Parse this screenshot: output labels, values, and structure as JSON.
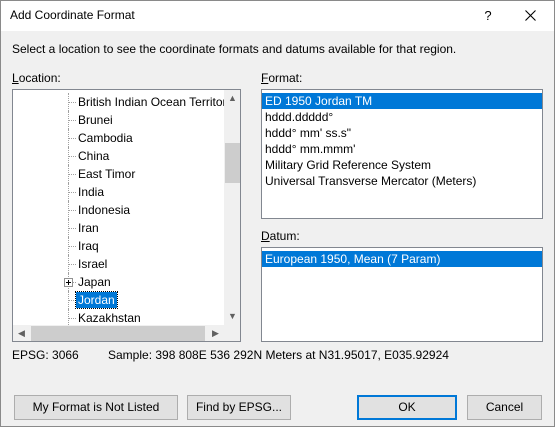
{
  "window": {
    "title": "Add Coordinate Format",
    "help_label": "?"
  },
  "instruction": "Select a location to see the coordinate formats and datums available for that region.",
  "location": {
    "label_accel": "L",
    "label_rest": "ocation:",
    "items": [
      {
        "label": "British Indian Ocean Territory"
      },
      {
        "label": "Brunei"
      },
      {
        "label": "Cambodia"
      },
      {
        "label": "China"
      },
      {
        "label": "East Timor"
      },
      {
        "label": "India"
      },
      {
        "label": "Indonesia"
      },
      {
        "label": "Iran"
      },
      {
        "label": "Iraq"
      },
      {
        "label": "Israel"
      },
      {
        "label": "Japan",
        "expandable": true
      },
      {
        "label": "Jordan",
        "selected": true
      },
      {
        "label": "Kazakhstan"
      }
    ]
  },
  "format": {
    "label_accel": "F",
    "label_rest": "ormat:",
    "items": [
      {
        "label": "ED 1950 Jordan TM",
        "selected": true
      },
      {
        "label": "hddd.ddddd°"
      },
      {
        "label": "hddd° mm' ss.s\""
      },
      {
        "label": "hddd° mm.mmm'"
      },
      {
        "label": "Military Grid Reference System"
      },
      {
        "label": "Universal Transverse Mercator (Meters)"
      }
    ]
  },
  "datum": {
    "label_accel": "D",
    "label_rest": "atum:",
    "items": [
      {
        "label": "European 1950, Mean (7 Param)",
        "selected": true
      }
    ]
  },
  "status": {
    "epsg": "EPSG: 3066",
    "sample": "Sample: 398 808E  536 292N Meters at N31.95017, E035.92924"
  },
  "buttons": {
    "not_listed": "My Format is Not Listed",
    "find_epsg": "Find by EPSG...",
    "ok": "OK",
    "cancel": "Cancel"
  },
  "colors": {
    "selection": "#0078d7",
    "dialog_bg": "#f0f0f0"
  }
}
